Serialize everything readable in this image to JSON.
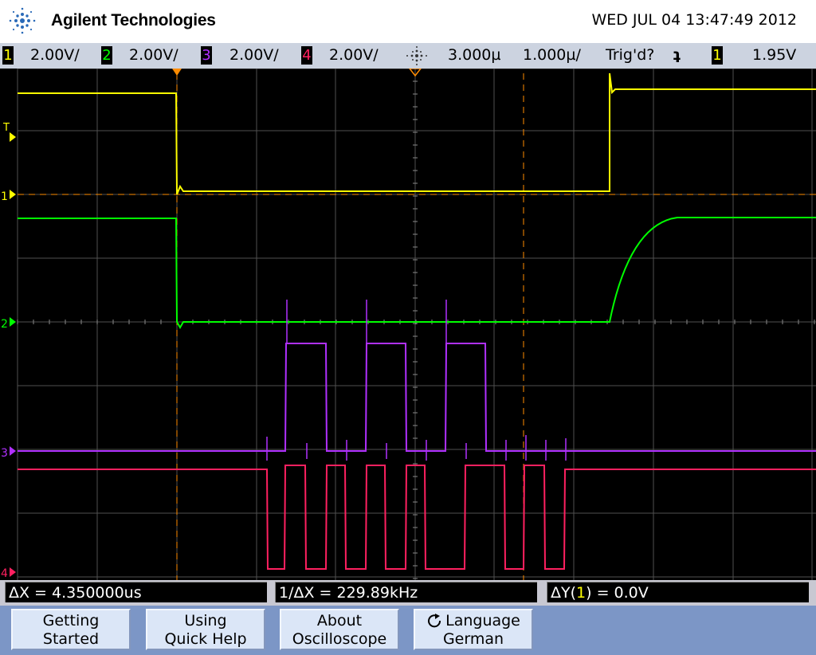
{
  "header": {
    "brand": "Agilent Technologies",
    "datetime": "WED JUL 04 13:47:49 2012"
  },
  "status_bar": {
    "channels": [
      {
        "num": "1",
        "scale": "2.00V/",
        "color": "#ffff00"
      },
      {
        "num": "2",
        "scale": "2.00V/",
        "color": "#00ff00"
      },
      {
        "num": "3",
        "scale": "2.00V/",
        "color": "#b030ff"
      },
      {
        "num": "4",
        "scale": "2.00V/",
        "color": "#ff2060"
      }
    ],
    "delay": "3.000µ",
    "timebase": "1.000µ/",
    "trigger_state": "Trig'd?",
    "trigger_slope": "ʇ",
    "trigger_source": "1",
    "trigger_level": "1.95V"
  },
  "screen": {
    "markers": {
      "t": "T",
      "ch1": "1",
      "ch2": "2",
      "ch3": "3",
      "ch4": "4"
    }
  },
  "measurements": {
    "delta_x": "ΔX = 4.350000us",
    "inv_delta_x": "1/ΔX = 229.89kHz",
    "delta_y_prefix": "ΔY(",
    "delta_y_source": "1",
    "delta_y_suffix": ") = 0.0V"
  },
  "softkeys": [
    {
      "line1": "Getting",
      "line2": "Started"
    },
    {
      "line1": "Using",
      "line2": "Quick Help"
    },
    {
      "line1": "About",
      "line2": "Oscilloscope"
    },
    {
      "line1": "Language",
      "line2": "German",
      "icon": "cycle-icon"
    }
  ],
  "colors": {
    "ch1": "#ffff00",
    "ch2": "#00ff00",
    "ch3": "#b030ff",
    "ch4": "#ff2060",
    "cursor": "#ff8c00",
    "grid": "#505050"
  }
}
